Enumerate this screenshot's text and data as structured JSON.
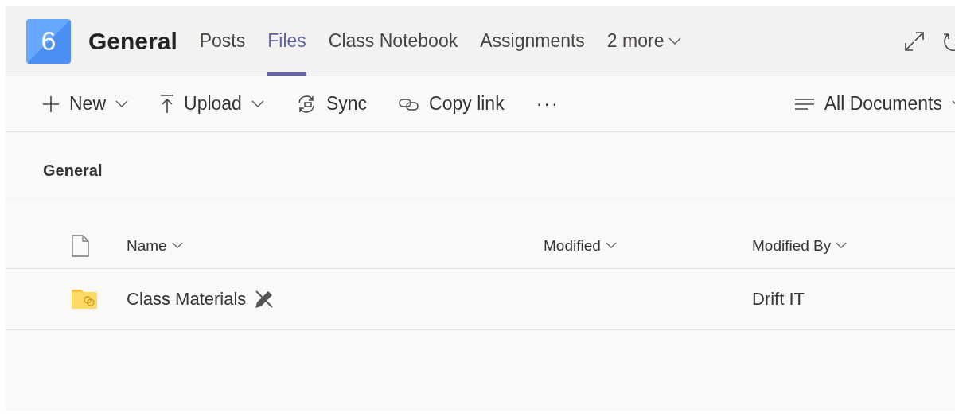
{
  "channel": {
    "badge": "6",
    "title": "General"
  },
  "tabs": [
    {
      "label": "Posts",
      "selected": false
    },
    {
      "label": "Files",
      "selected": true
    },
    {
      "label": "Class Notebook",
      "selected": false
    },
    {
      "label": "Assignments",
      "selected": false
    },
    {
      "label": "2 more",
      "selected": false,
      "kind": "more"
    }
  ],
  "toolbar": {
    "items": [
      {
        "label": "New",
        "kind": "new"
      },
      {
        "label": "Upload",
        "kind": "upload"
      },
      {
        "label": "Sync",
        "kind": "sync"
      },
      {
        "label": "Copy link",
        "kind": "link"
      },
      {
        "label": "···",
        "kind": "overflow"
      }
    ],
    "view": "All Documents"
  },
  "library": {
    "title": "General",
    "columns": [
      "Name",
      "Modified",
      "Modified By"
    ],
    "rows": [
      {
        "name": "Class Materials",
        "modified_by": "Drift IT"
      }
    ]
  }
}
